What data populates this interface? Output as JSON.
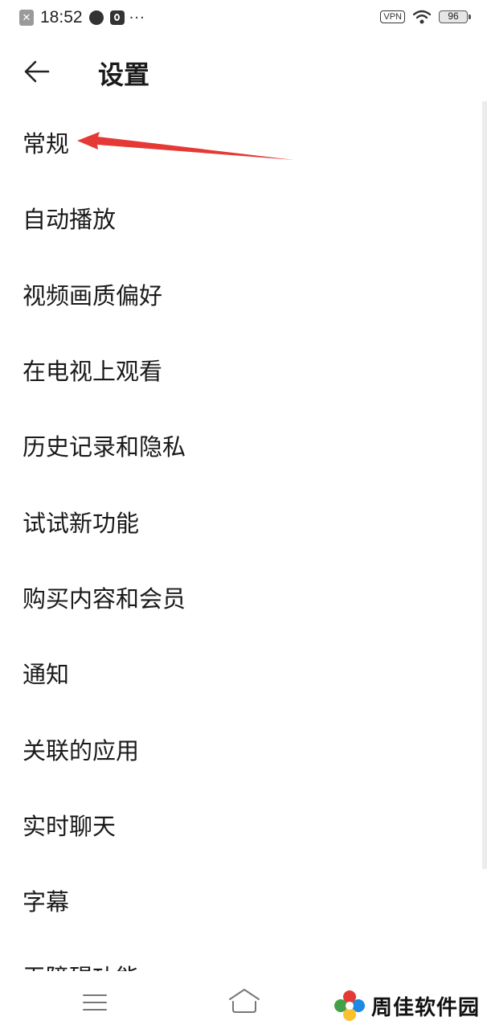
{
  "status_bar": {
    "time": "18:52",
    "more": "···",
    "vpn_label": "VPN",
    "battery": "96",
    "icons": [
      "close-notification-icon",
      "app-icon",
      "tiktok-icon",
      "wifi-icon"
    ]
  },
  "header": {
    "title": "设置",
    "back_icon": "arrow-left-icon"
  },
  "settings": {
    "items": [
      {
        "label": "常规"
      },
      {
        "label": "自动播放"
      },
      {
        "label": "视频画质偏好"
      },
      {
        "label": "在电视上观看"
      },
      {
        "label": "历史记录和隐私"
      },
      {
        "label": "试试新功能"
      },
      {
        "label": "购买内容和会员"
      },
      {
        "label": "通知"
      },
      {
        "label": "关联的应用"
      },
      {
        "label": "实时聊天"
      },
      {
        "label": "字幕"
      },
      {
        "label": "无障碍功能"
      }
    ]
  },
  "nav_bar": {
    "icons": [
      "menu-icon",
      "home-icon"
    ]
  },
  "watermark": {
    "text": "周佳软件园"
  },
  "colors": {
    "annotation_arrow": "#e53935",
    "text": "#1a1a1a",
    "background": "#ffffff"
  }
}
